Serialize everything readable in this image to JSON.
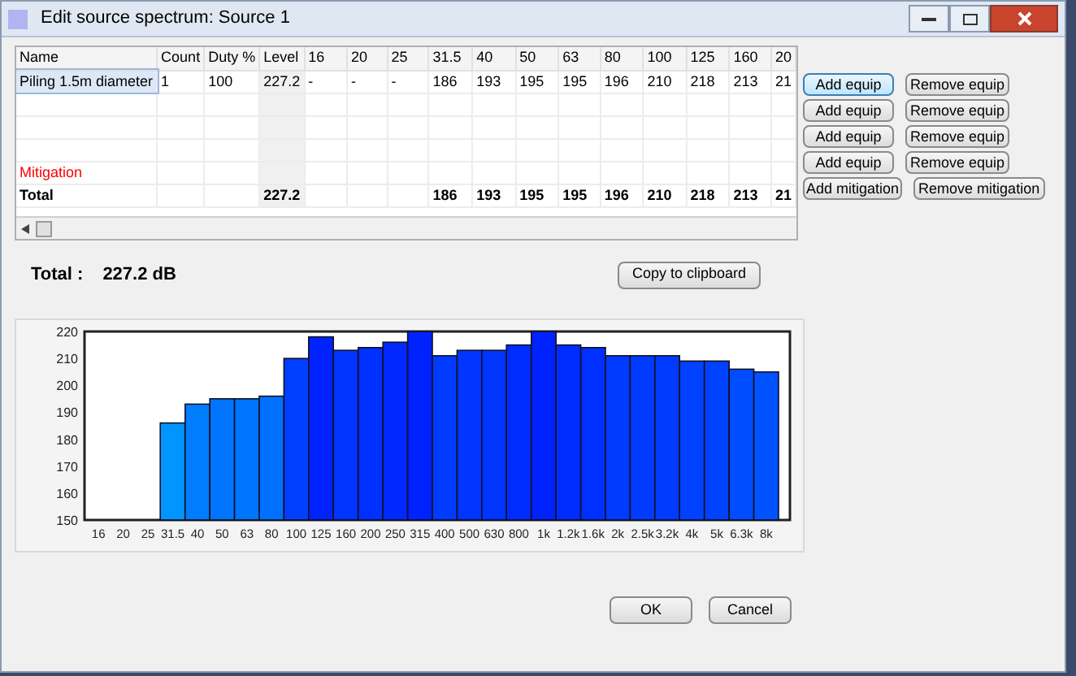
{
  "window": {
    "title": "Edit source spectrum: Source 1"
  },
  "table": {
    "columns": [
      "Name",
      "Count",
      "Duty %",
      "Level",
      "16",
      "20",
      "25",
      "31.5",
      "40",
      "50",
      "63",
      "80",
      "100",
      "125",
      "160",
      "20"
    ],
    "rows": [
      {
        "kind": "data",
        "selected": true,
        "cells": [
          "Piling 1.5m diameter",
          "1",
          "100",
          "227.2",
          "-",
          "-",
          "-",
          "186",
          "193",
          "195",
          "195",
          "196",
          "210",
          "218",
          "213",
          "21"
        ]
      },
      {
        "kind": "empty"
      },
      {
        "kind": "empty"
      },
      {
        "kind": "empty"
      },
      {
        "kind": "mitigation",
        "cells": [
          "Mitigation"
        ]
      },
      {
        "kind": "total",
        "cells": [
          "Total",
          null,
          null,
          "227.2",
          null,
          null,
          null,
          "186",
          "193",
          "195",
          "195",
          "196",
          "210",
          "218",
          "213",
          "21"
        ]
      }
    ]
  },
  "side_buttons": [
    {
      "add": "Add equip",
      "remove": "Remove equip",
      "focused": true
    },
    {
      "add": "Add equip",
      "remove": "Remove equip",
      "focused": false
    },
    {
      "add": "Add equip",
      "remove": "Remove equip",
      "focused": false
    },
    {
      "add": "Add equip",
      "remove": "Remove equip",
      "focused": false
    },
    {
      "add": "Add mitigation",
      "remove": "Remove mitigation",
      "focused": false
    }
  ],
  "total": {
    "label": "Total :",
    "value": "227.2 dB"
  },
  "copy_button": "Copy to clipboard",
  "chart": {
    "chart_data": {
      "type": "bar",
      "categories": [
        "16",
        "20",
        "25",
        "31.5",
        "40",
        "50",
        "63",
        "80",
        "100",
        "125",
        "160",
        "200",
        "250",
        "315",
        "400",
        "500",
        "630",
        "800",
        "1k",
        "1.2k",
        "1.6k",
        "2k",
        "2.5k",
        "3.2k",
        "4k",
        "5k",
        "6.3k",
        "8k"
      ],
      "series": [
        {
          "values": [
            null,
            null,
            null,
            186,
            193,
            195,
            195,
            196,
            210,
            218,
            213,
            214,
            216,
            220,
            211,
            213,
            213,
            215,
            220,
            215,
            214,
            211,
            211,
            211,
            209,
            209,
            206,
            205
          ]
        }
      ],
      "ylim": [
        150,
        220
      ],
      "yticks": [
        150,
        160,
        170,
        180,
        190,
        200,
        210,
        220
      ]
    }
  },
  "buttons": [
    "OK",
    "Cancel"
  ]
}
